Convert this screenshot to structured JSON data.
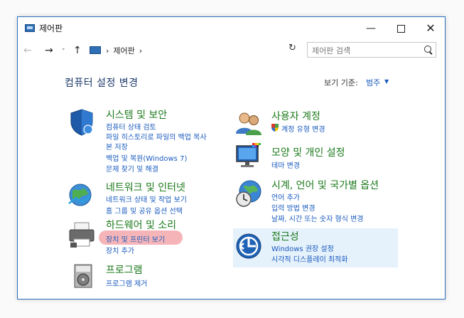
{
  "window": {
    "title": "제어판",
    "controls": {
      "minimize": "—",
      "maximize": "",
      "close": "✕"
    }
  },
  "addressbar": {
    "back": "←",
    "forward": "→",
    "recent": "˅",
    "up": "↑",
    "path": [
      "›",
      "제어판",
      "›"
    ],
    "dropdown": "˅",
    "refresh": "↻",
    "search_placeholder": "제어판 검색"
  },
  "main": {
    "heading": "컴퓨터 설정 변경",
    "view_by_label": "보기 기준:",
    "view_by_value": "범주",
    "view_by_caret": "▼"
  },
  "categories": [
    {
      "icon": "shield-icon",
      "title": "시스템 및 보안",
      "links": [
        "컴퓨터 상태 검토",
        "파일 히스토리로 파일의 백업 복사",
        "본 저장",
        "백업 및 복원(Windows 7)",
        "문제 찾기 및 해결"
      ]
    },
    {
      "icon": "network-globe-icon",
      "title": "네트워크 및 인터넷",
      "links": [
        "네트워크 상태 및 작업 보기",
        "홈 그룹 및 공유 옵션 선택"
      ]
    },
    {
      "icon": "printer-icon",
      "title": "하드웨어 및 소리",
      "links": [
        "장치 및 프린터 보기",
        "장치 추가"
      ]
    },
    {
      "icon": "programs-icon",
      "title": "프로그램",
      "links": [
        "프로그램 제거"
      ]
    },
    {
      "icon": "users-icon",
      "title": "사용자 계정",
      "links": [
        "계정 유형 변경"
      ]
    },
    {
      "icon": "monitor-palette-icon",
      "title": "모양 및 개인 설정",
      "links": [
        "테마 변경"
      ]
    },
    {
      "icon": "clock-globe-icon",
      "title": "시계, 언어 및 국가별 옵션",
      "links": [
        "언어 추가",
        "입력 방법 변경",
        "날짜, 시간 또는 숫자 형식 변경"
      ]
    },
    {
      "icon": "accessibility-icon",
      "title": "접근성",
      "links": [
        "Windows 권장 설정",
        "시각적 디스플레이 최적화"
      ]
    }
  ],
  "colors": {
    "category_title": "#1c7a1c",
    "link": "#1a5bbf",
    "heading": "#1d3a6b",
    "highlight": "#f3a8ab",
    "hover_bg": "#e5f1fb"
  }
}
